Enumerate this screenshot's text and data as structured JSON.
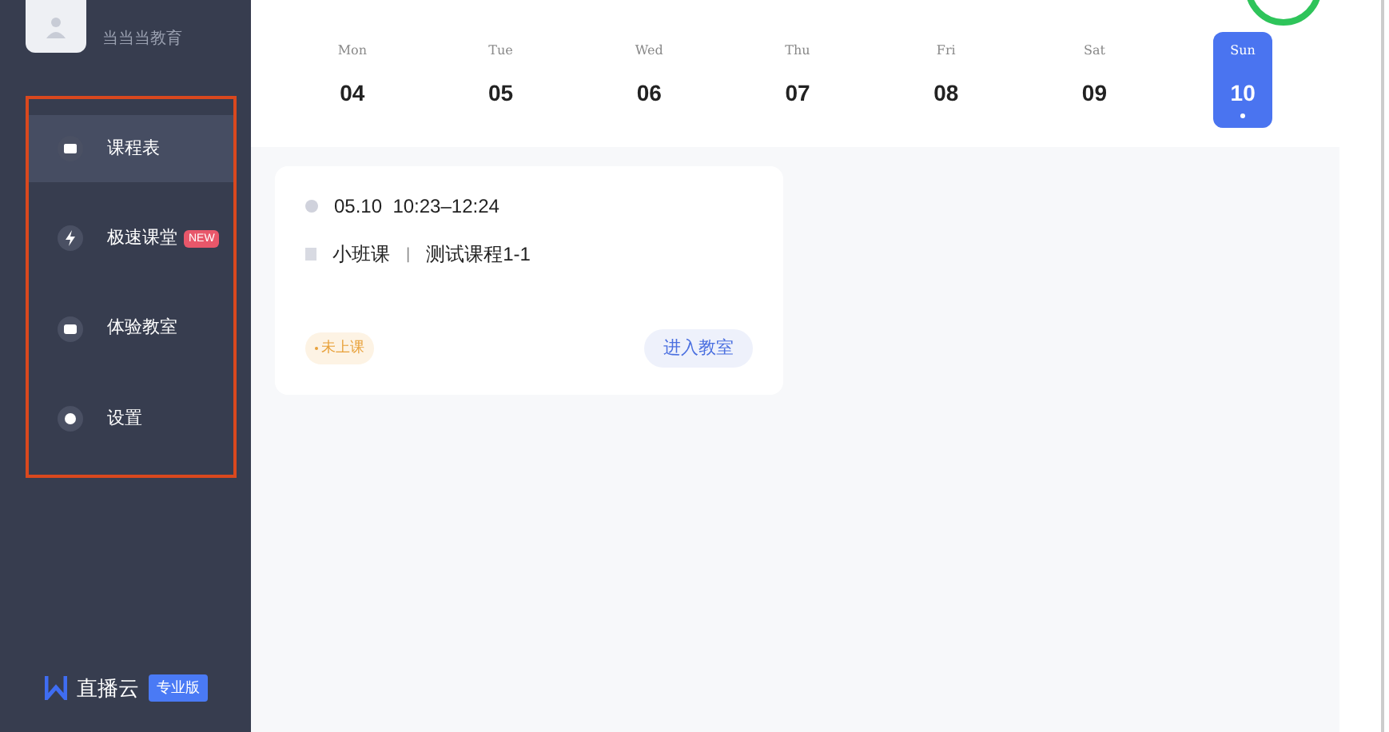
{
  "profile": {
    "school": "当当当教育"
  },
  "menu": [
    {
      "label": "课程表",
      "kind": "schedule",
      "selected": true
    },
    {
      "label": "极速课堂",
      "kind": "flash",
      "selected": false,
      "badge": "NEW"
    },
    {
      "label": "体验教室",
      "kind": "video",
      "selected": false
    },
    {
      "label": "设置",
      "kind": "settings",
      "selected": false
    }
  ],
  "brand": {
    "name": "直播云",
    "edition": "专业版"
  },
  "week": [
    {
      "day": "Mon",
      "date": "04",
      "selected": false
    },
    {
      "day": "Tue",
      "date": "05",
      "selected": false
    },
    {
      "day": "Wed",
      "date": "06",
      "selected": false
    },
    {
      "day": "Thu",
      "date": "07",
      "selected": false
    },
    {
      "day": "Fri",
      "date": "08",
      "selected": false
    },
    {
      "day": "Sat",
      "date": "09",
      "selected": false
    },
    {
      "day": "Sun",
      "date": "10",
      "selected": true
    }
  ],
  "lessons": [
    {
      "time": "05.10  10:23–12:24",
      "type": "小班课",
      "separator": "|",
      "course": "测试课程1-1",
      "status": "未上课",
      "action": "进入教室"
    }
  ]
}
